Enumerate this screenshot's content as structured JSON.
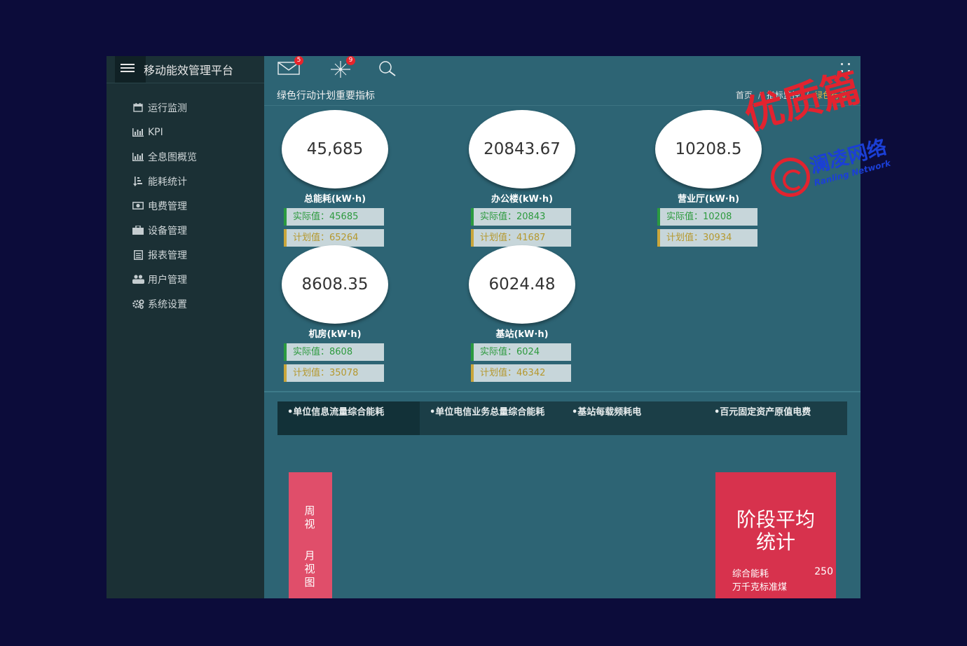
{
  "app": {
    "title": "移动能效管理平台"
  },
  "sidebar": {
    "items": [
      {
        "label": "运行监测",
        "icon": "calendar-icon"
      },
      {
        "label": "KPI",
        "icon": "bar-chart-icon"
      },
      {
        "label": "全息图概览",
        "icon": "bar-chart-icon"
      },
      {
        "label": "能耗统计",
        "icon": "sort-amount-icon"
      },
      {
        "label": "电费管理",
        "icon": "money-icon"
      },
      {
        "label": "设备管理",
        "icon": "briefcase-icon"
      },
      {
        "label": "报表管理",
        "icon": "list-alt-icon"
      },
      {
        "label": "用户管理",
        "icon": "users-icon"
      },
      {
        "label": "系统设置",
        "icon": "cogs-icon"
      }
    ]
  },
  "topbar": {
    "mail_badge": "5",
    "alerts_badge": "9"
  },
  "header": {
    "page_title": "绿色行动计划重要指标",
    "breadcrumb": [
      "首页",
      "指标监控",
      "绿色行动"
    ]
  },
  "kpis": [
    {
      "value": "45,685",
      "label": "总能耗(kW·h)",
      "actual": "实际值：45685",
      "plan": "计划值：65264"
    },
    {
      "value": "20843.67",
      "label": "办公楼(kW·h)",
      "actual": "实际值：20843",
      "plan": "计划值：41687"
    },
    {
      "value": "10208.5",
      "label": "营业厅(kW·h)",
      "actual": "实际值：10208",
      "plan": "计划值：30934"
    },
    {
      "value": "8608.35",
      "label": "机房(kW·h)",
      "actual": "实际值：8608",
      "plan": "计划值：35078"
    },
    {
      "value": "6024.48",
      "label": "基站(kW·h)",
      "actual": "实际值：6024",
      "plan": "计划值：46342"
    }
  ],
  "tabs": [
    {
      "label": "•单位信息流量综合能耗"
    },
    {
      "label": "•单位电信业务总量综合能耗"
    },
    {
      "label": "•基站每载频耗电"
    },
    {
      "label": "•百元固定资产原值电费"
    }
  ],
  "period_panel": {
    "week": [
      "周",
      "视"
    ],
    "month": [
      "月",
      "视",
      "图"
    ]
  },
  "stats": {
    "title_line1": "阶段平均",
    "title_line2": "统计",
    "metric_label": "综合能耗",
    "metric_value": "250",
    "metric_unit": "万千克标准煤"
  },
  "watermark": {
    "main": "优质篇",
    "sub": "澜凌网络",
    "en": "Ranling Network"
  },
  "colors": {
    "app_bg": "#2d6474",
    "sidebar_bg": "#1b3035",
    "page_bg": "#0c0c3a",
    "actual_green": "#2d9a3e",
    "plan_gold": "#b5982e",
    "period_pink": "#e04e6a",
    "stats_red": "#d7324d",
    "badge_red": "#e8242b"
  }
}
